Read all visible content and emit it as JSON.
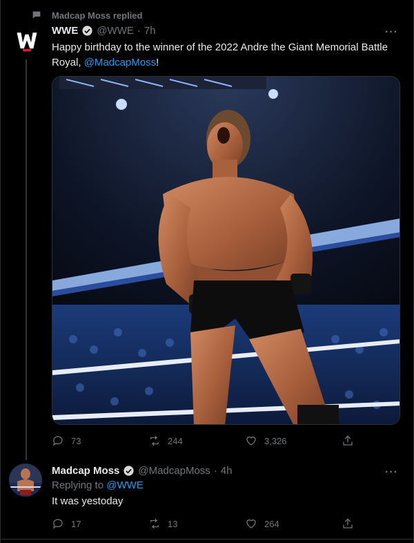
{
  "context": {
    "text": "Madcap Moss replied",
    "icon": "speech-bubble-icon"
  },
  "tweet1": {
    "name": "WWE",
    "handle": "@WWE",
    "dot": "·",
    "time": "7h",
    "text_before": "Happy birthday to the winner of the 2022 Andre the Giant Memorial Battle Royal, ",
    "mention": "@MadcapMoss",
    "text_after": "!",
    "more": "···",
    "stats": {
      "replies": "73",
      "retweets": "244",
      "likes": "3,326"
    }
  },
  "tweet2": {
    "name": "Madcap Moss",
    "handle": "@MadcapMoss",
    "dot": "·",
    "time": "4h",
    "replying_prefix": "Replying to ",
    "replying_to": "@WWE",
    "text": "It was yestoday",
    "more": "···",
    "stats": {
      "replies": "17",
      "retweets": "13",
      "likes": "264"
    }
  },
  "colors": {
    "accent": "#1d9bf0",
    "muted": "#71767b",
    "text": "#e7e9ea",
    "background": "#000000"
  }
}
